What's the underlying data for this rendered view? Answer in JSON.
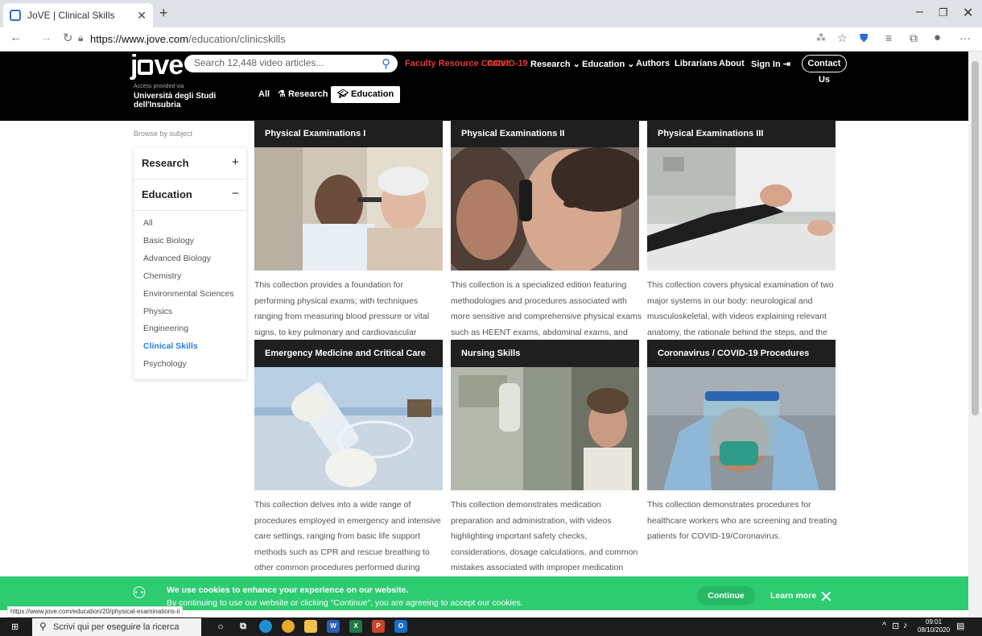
{
  "browser": {
    "tab_title": "JoVE | Clinical Skills",
    "url_host": "https://www.jove.com",
    "url_path": "/education/clinicskills"
  },
  "header": {
    "search_placeholder": "Search 12,448 video articles...",
    "nav": {
      "faculty": "Faculty Resource Center",
      "covid": "COVID-19",
      "research": "Research",
      "education": "Education",
      "authors": "Authors",
      "librarians": "Librarians",
      "about": "About",
      "signin": "Sign In",
      "contact": "Contact Us"
    },
    "access_label": "Access provided via",
    "institution": "Università degli Studi dell'Insubria",
    "modes": {
      "all": "All",
      "research": "Research",
      "education": "Education"
    }
  },
  "page": {
    "browse_label": "Browse by subject"
  },
  "sidebar": {
    "research": "Research",
    "education": "Education",
    "items": [
      "All",
      "Basic Biology",
      "Advanced Biology",
      "Chemistry",
      "Environmental Sciences",
      "Physics",
      "Engineering",
      "Clinical Skills",
      "Psychology"
    ]
  },
  "cards": [
    {
      "title": "Physical Examinations I",
      "desc": "This collection provides a foundation for performing physical exams; with techniques ranging from measuring blood pressure or vital signs, to key pulmonary and cardiovascular physical examinations."
    },
    {
      "title": "Physical Examinations II",
      "desc": "This collection is a specialized edition featuring methodologies and procedures associated with more sensitive and comprehensive physical exams such as HEENT exams, abdominal exams, and pelvic exams."
    },
    {
      "title": "Physical Examinations III",
      "desc": "This collection covers physical examination of two major systems in our body: neurological and musculoskeletal, with videos explaining relevant anatomy, the rationale behind the steps, and the interpretation of the exam findings."
    },
    {
      "title": "Emergency Medicine and Critical Care",
      "desc": "This collection delves into a wide range of procedures employed in emergency and intensive care settings, ranging from basic life support methods such as CPR and rescue breathing to other common procedures performed during emergency situations."
    },
    {
      "title": "Nursing Skills",
      "desc": "This collection demonstrates medication preparation and administration, with videos highlighting important safety checks, considerations, dosage calculations, and common mistakes associated with improper medication administration."
    },
    {
      "title": "Coronavirus / COVID-19 Procedures",
      "desc": "This collection demonstrates procedures for healthcare workers who are screening and treating patients for COVID-19/Coronavirus."
    }
  ],
  "cookie": {
    "title": "We use cookies to enhance your experience on our website.",
    "body": "By continuing to use our website or clicking \"Continue\", you are agreeing to accept our cookies.",
    "continue": "Continue",
    "learn_more": "Learn more"
  },
  "status_url": "https://www.jove.com/education/20/physical-examinations-ii",
  "taskbar": {
    "search_placeholder": "Scrivi qui per eseguire la ricerca",
    "time": "09:01",
    "date": "08/10/2020"
  }
}
